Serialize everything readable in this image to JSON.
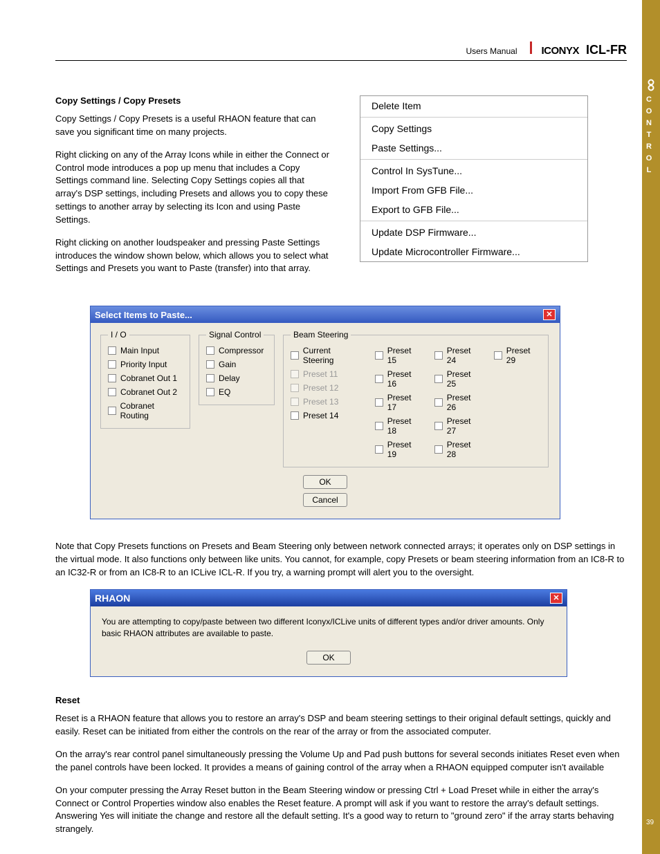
{
  "header": {
    "users_manual": "Users Manual",
    "brand": "ICONYX",
    "model": "ICL-FR"
  },
  "section1": {
    "heading": "Copy Settings / Copy Presets",
    "p1": "Copy Settings / Copy Presets is a useful RHAON feature that can save you significant time on many projects.",
    "p2": "Right clicking on any of the Array Icons while in either the Connect or Control mode introduces a pop up menu that includes a Copy Settings command line. Selecting Copy Settings copies all that array's DSP settings, including Presets and allows you to copy these settings to another array by selecting its Icon and using Paste Settings.",
    "p3": "Right clicking on another loudspeaker and pressing Paste Settings introduces the window shown below, which allows you to select what Settings and Presets you want to Paste (transfer) into that array."
  },
  "context_menu": {
    "items": [
      "Delete Item",
      "Copy Settings",
      "Paste Settings...",
      "Control In SysTune...",
      "Import From GFB File...",
      "Export to GFB File...",
      "Update DSP Firmware...",
      "Update Microcontroller Firmware..."
    ]
  },
  "paste_dialog": {
    "title": "Select Items to Paste...",
    "groups": {
      "io": {
        "legend": "I / O",
        "items": [
          "Main Input",
          "Priority Input",
          "Cobranet Out 1",
          "Cobranet Out 2",
          "Cobranet Routing"
        ]
      },
      "signal": {
        "legend": "Signal Control",
        "items": [
          "Compressor",
          "Gain",
          "Delay",
          "EQ"
        ]
      },
      "beam": {
        "legend": "Beam Steering",
        "cols": [
          [
            {
              "label": "Current Steering",
              "enabled": true
            },
            {
              "label": "Preset 11",
              "enabled": false
            },
            {
              "label": "Preset 12",
              "enabled": false
            },
            {
              "label": "Preset 13",
              "enabled": false
            },
            {
              "label": "Preset 14",
              "enabled": true
            }
          ],
          [
            {
              "label": "Preset 15",
              "enabled": true
            },
            {
              "label": "Preset 16",
              "enabled": true
            },
            {
              "label": "Preset 17",
              "enabled": true
            },
            {
              "label": "Preset 18",
              "enabled": true
            },
            {
              "label": "Preset 19",
              "enabled": true
            }
          ],
          [
            {
              "label": "Preset 24",
              "enabled": true
            },
            {
              "label": "Preset 25",
              "enabled": true
            },
            {
              "label": "Preset 26",
              "enabled": true
            },
            {
              "label": "Preset 27",
              "enabled": true
            },
            {
              "label": "Preset 28",
              "enabled": true
            }
          ],
          [
            {
              "label": "Preset 29",
              "enabled": true
            }
          ]
        ]
      }
    },
    "ok": "OK",
    "cancel": "Cancel"
  },
  "note_para": "Note that Copy Presets functions on Presets and Beam Steering only between network connected arrays; it operates only on DSP settings in the virtual mode. It also functions only between like units. You cannot, for example, copy Presets or beam steering information from an IC8-R to an IC32-R or from an IC8-R to an ICLive ICL-R. If you try, a warning prompt will alert you to the oversight.",
  "warn_dialog": {
    "title": "RHAON",
    "body": "You are attempting to copy/paste between two different Iconyx/ICLive units of different types and/or driver amounts. Only basic RHAON attributes are available to paste.",
    "ok": "OK"
  },
  "reset": {
    "heading": "Reset",
    "p1": "Reset is a RHAON feature that allows you to restore an array's DSP and beam steering settings to their original default settings, quickly and easily. Reset can be initiated from either the controls on the rear of the array or from the associated computer.",
    "p2": "On the array's rear control panel simultaneously pressing the Volume Up and Pad push buttons for several seconds initiates Reset even when the panel controls have been locked. It provides a means of gaining control of the array when a RHAON equipped  computer isn't available",
    "p3": "On your computer pressing the Array Reset button in the Beam Steering window or pressing Ctrl + Load Preset while in either the array's Connect or Control Properties window also enables the Reset feature. A prompt will ask if you want to restore the array's default settings. Answering Yes will initiate the change and restore all the default setting. It's a good way to return to \"ground zero\" if the array starts behaving strangely."
  },
  "band": {
    "label": "CONTROL",
    "page": "39"
  }
}
